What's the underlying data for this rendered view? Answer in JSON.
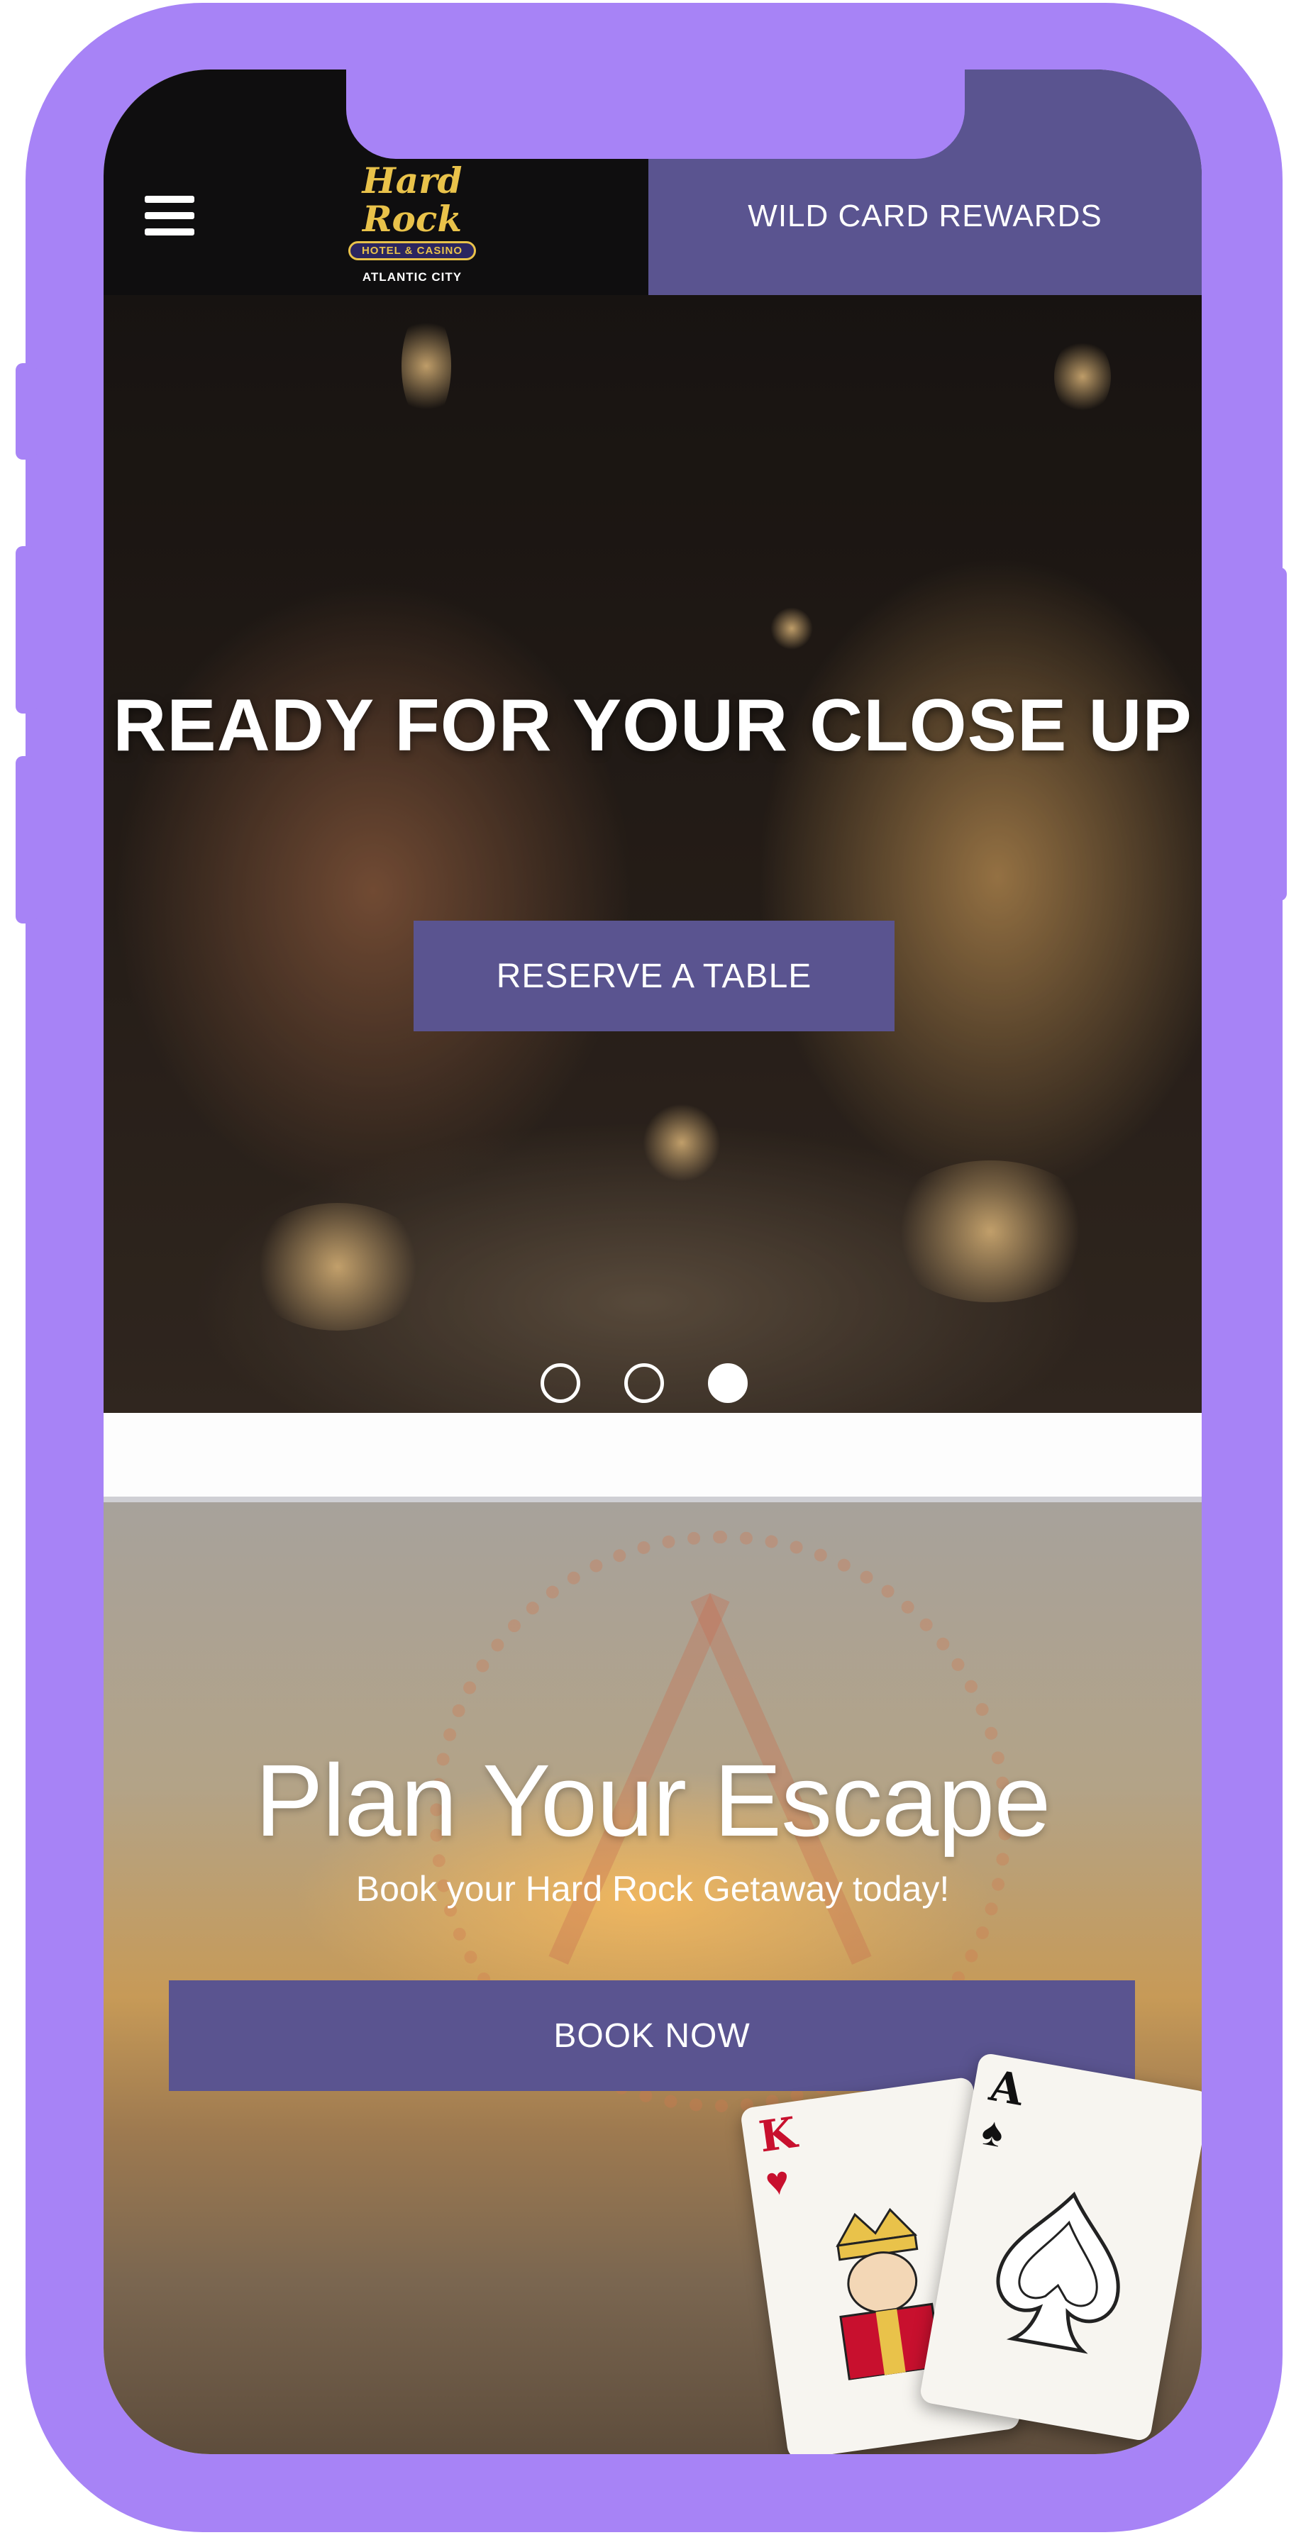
{
  "header": {
    "menu_icon": "hamburger-menu-icon",
    "logo": {
      "script": "Hard Rock",
      "badge": "HOTEL & CASINO",
      "city": "ATLANTIC CITY"
    },
    "rewards_label": "WILD CARD REWARDS"
  },
  "hero": {
    "title": "READY FOR YOUR CLOSE UP",
    "button_label": "RESERVE A TABLE",
    "slides": 3,
    "active_slide": 3
  },
  "escape": {
    "title": "Plan Your Escape",
    "subtitle": "Book your Hard Rock Getaway today!",
    "button_label": "BOOK NOW"
  },
  "cards": [
    {
      "rank": "K",
      "suit": "♥",
      "color": "#c8102e"
    },
    {
      "rank": "A",
      "suit": "♠",
      "color": "#111111"
    }
  ],
  "colors": {
    "frame": "#a783f6",
    "accent": "#5a5490",
    "header_bg": "#0f0e0f",
    "logo_gold": "#e9c24a"
  }
}
